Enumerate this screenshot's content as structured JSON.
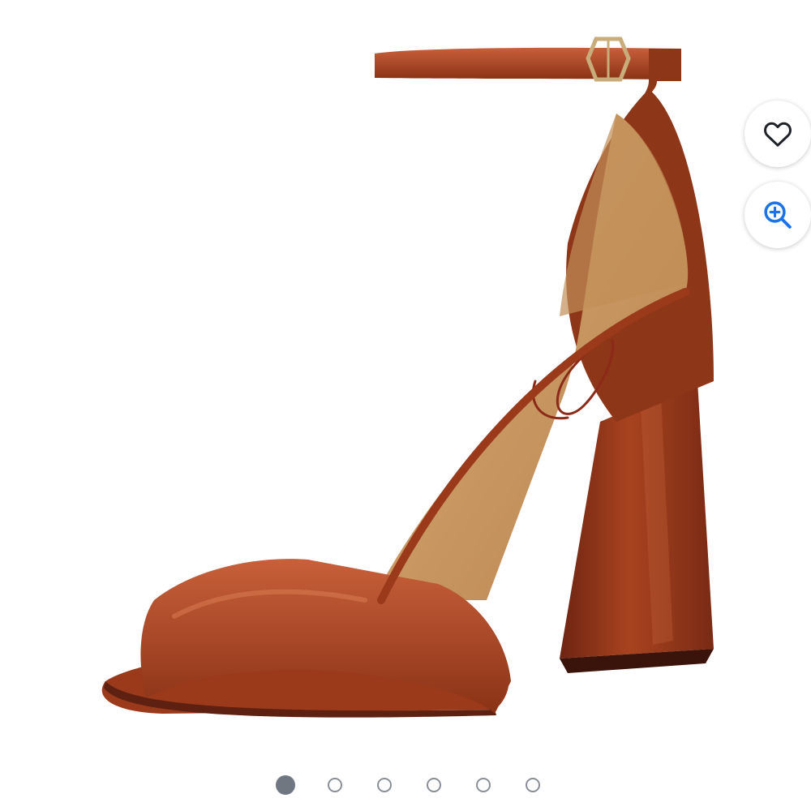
{
  "gallery": {
    "total_images": 6,
    "active_index": 0
  },
  "actions": {
    "favorite_icon": "heart-icon",
    "zoom_icon": "zoom-in-icon",
    "zoom_color": "#1a73e8"
  },
  "product": {
    "image_subject": "sandal-icon",
    "colors": {
      "leather": "#9c3d1c",
      "leather_highlight": "#c65a34",
      "leather_dark": "#5e2010",
      "lining": "#c9955e",
      "buckle": "#c8ad7a"
    }
  }
}
